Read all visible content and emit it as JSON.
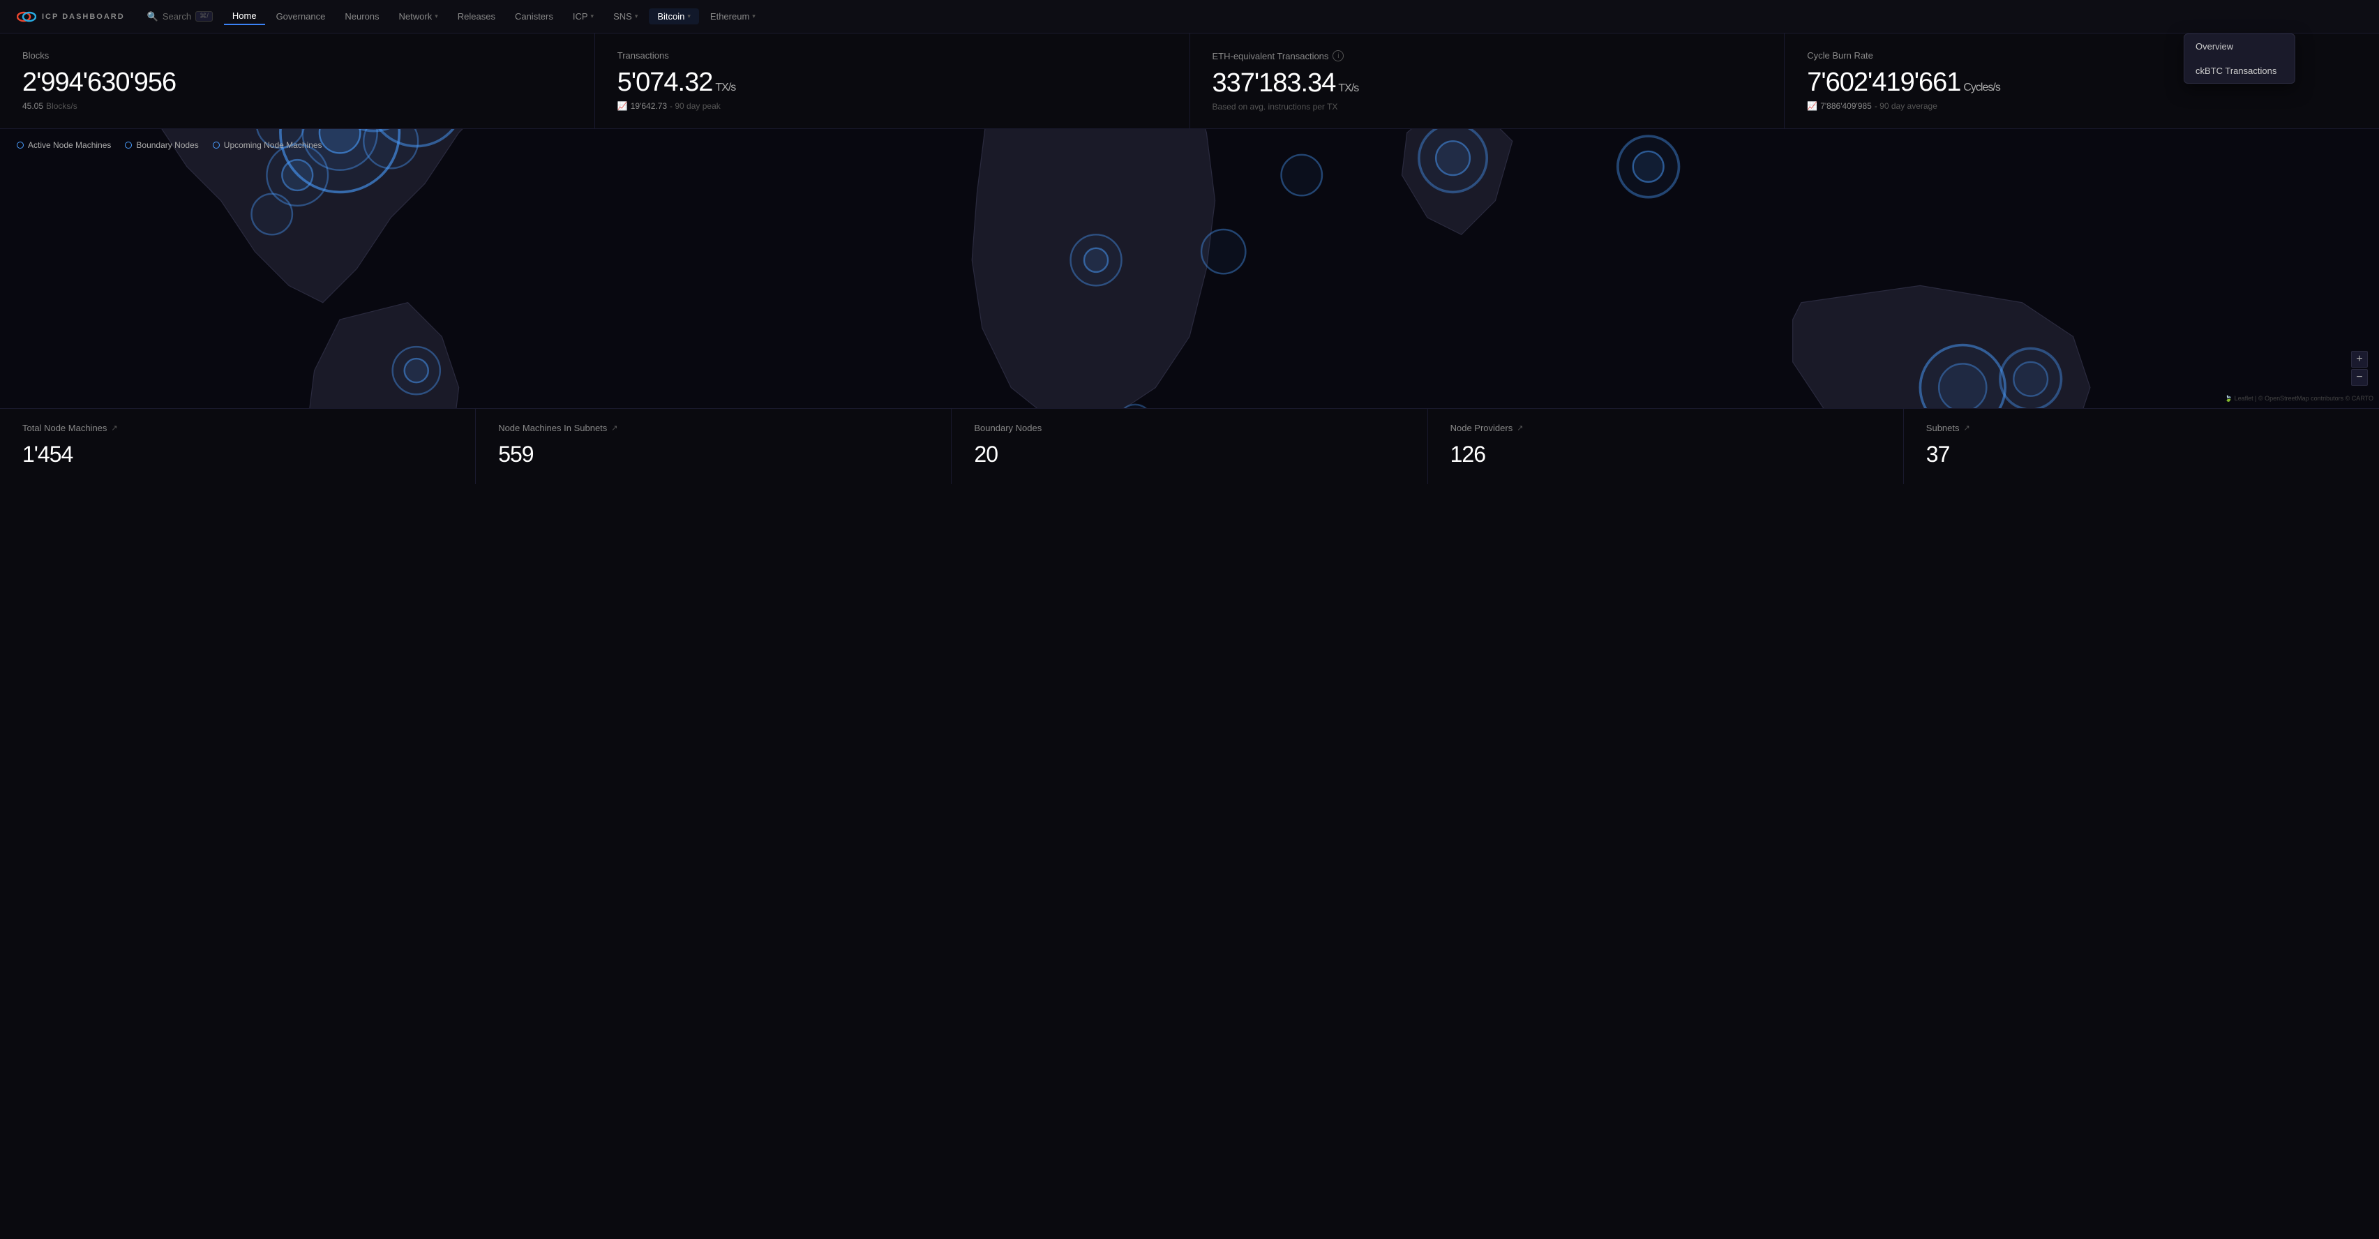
{
  "logo": {
    "text": "ICP DASHBOARD"
  },
  "nav": {
    "search_label": "Search",
    "search_shortcut": "⌘/",
    "items": [
      {
        "id": "home",
        "label": "Home",
        "active": true,
        "dropdown": false
      },
      {
        "id": "governance",
        "label": "Governance",
        "active": false,
        "dropdown": false
      },
      {
        "id": "neurons",
        "label": "Neurons",
        "active": false,
        "dropdown": false
      },
      {
        "id": "network",
        "label": "Network",
        "active": false,
        "dropdown": true
      },
      {
        "id": "releases",
        "label": "Releases",
        "active": false,
        "dropdown": false
      },
      {
        "id": "canisters",
        "label": "Canisters",
        "active": false,
        "dropdown": false
      },
      {
        "id": "icp",
        "label": "ICP",
        "active": false,
        "dropdown": true
      },
      {
        "id": "sns",
        "label": "SNS",
        "active": false,
        "dropdown": true
      },
      {
        "id": "bitcoin",
        "label": "Bitcoin",
        "active": true,
        "dropdown": true
      },
      {
        "id": "ethereum",
        "label": "Ethereum",
        "active": false,
        "dropdown": true
      }
    ]
  },
  "bitcoin_dropdown": {
    "items": [
      {
        "id": "overview",
        "label": "Overview"
      },
      {
        "id": "ckbtc",
        "label": "ckBTC Transactions"
      }
    ]
  },
  "stats": [
    {
      "id": "blocks",
      "label": "Blocks",
      "value": "2'994'630'956",
      "sub": "45.05",
      "sub_unit": "Blocks/s",
      "has_info": false
    },
    {
      "id": "transactions",
      "label": "Transactions",
      "value": "5'074.32",
      "value_unit": "TX/s",
      "sub": "19'642.73",
      "sub_suffix": "- 90 day peak",
      "has_trend": true,
      "has_info": false
    },
    {
      "id": "eth_transactions",
      "label": "ETH-equivalent Transactions",
      "value": "337'183.34",
      "value_unit": "TX/s",
      "sub": "Based on avg. instructions per TX",
      "has_info": true,
      "has_trend": false
    },
    {
      "id": "cycle_burn",
      "label": "Cycle Burn Rate",
      "value": "7'602'419'661",
      "value_unit": "Cycles/s",
      "sub": "7'886'409'985",
      "sub_suffix": "- 90 day average",
      "has_trend": true,
      "has_info": false
    }
  ],
  "map": {
    "legend": [
      {
        "id": "active",
        "label": "Active Node Machines"
      },
      {
        "id": "boundary",
        "label": "Boundary Nodes"
      },
      {
        "id": "upcoming",
        "label": "Upcoming Node Machines"
      }
    ],
    "zoom_plus": "+",
    "zoom_minus": "−",
    "attribution": "Leaflet | © OpenStreetMap contributors © CARTO"
  },
  "bottom_stats": [
    {
      "id": "total_nodes",
      "label": "Total Node Machines",
      "value": "1'454",
      "has_ext": true
    },
    {
      "id": "nodes_in_subnets",
      "label": "Node Machines In Subnets",
      "value": "559",
      "has_ext": true
    },
    {
      "id": "boundary_nodes",
      "label": "Boundary Nodes",
      "value": "20",
      "has_ext": false
    },
    {
      "id": "node_providers",
      "label": "Node Providers",
      "value": "126",
      "has_ext": true
    },
    {
      "id": "subnets",
      "label": "Subnets",
      "value": "37",
      "has_ext": true
    }
  ]
}
